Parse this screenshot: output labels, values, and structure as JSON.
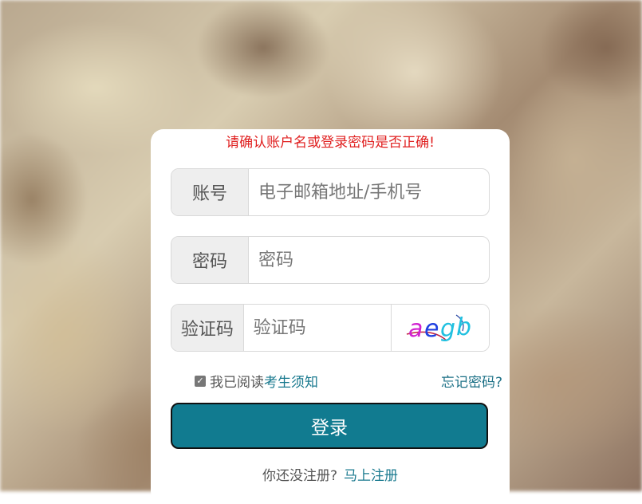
{
  "error_message": "请确认账户名或登录密码是否正确!",
  "account": {
    "label": "账号",
    "placeholder": "电子邮箱地址/手机号",
    "value": ""
  },
  "password": {
    "label": "密码",
    "placeholder": "密码",
    "value": ""
  },
  "captcha": {
    "label": "验证码",
    "placeholder": "验证码",
    "value": "",
    "image_text": "aegb"
  },
  "agreement": {
    "checked": true,
    "prefix": "我已阅读",
    "link_text": "考生须知"
  },
  "forgot_password": "忘记密码?",
  "login_button": "登录",
  "register": {
    "prompt": "你还没注册?",
    "link_text": "马上注册"
  },
  "colors": {
    "accent": "#117b90",
    "error": "#e02020",
    "link": "#1a7a8f"
  }
}
